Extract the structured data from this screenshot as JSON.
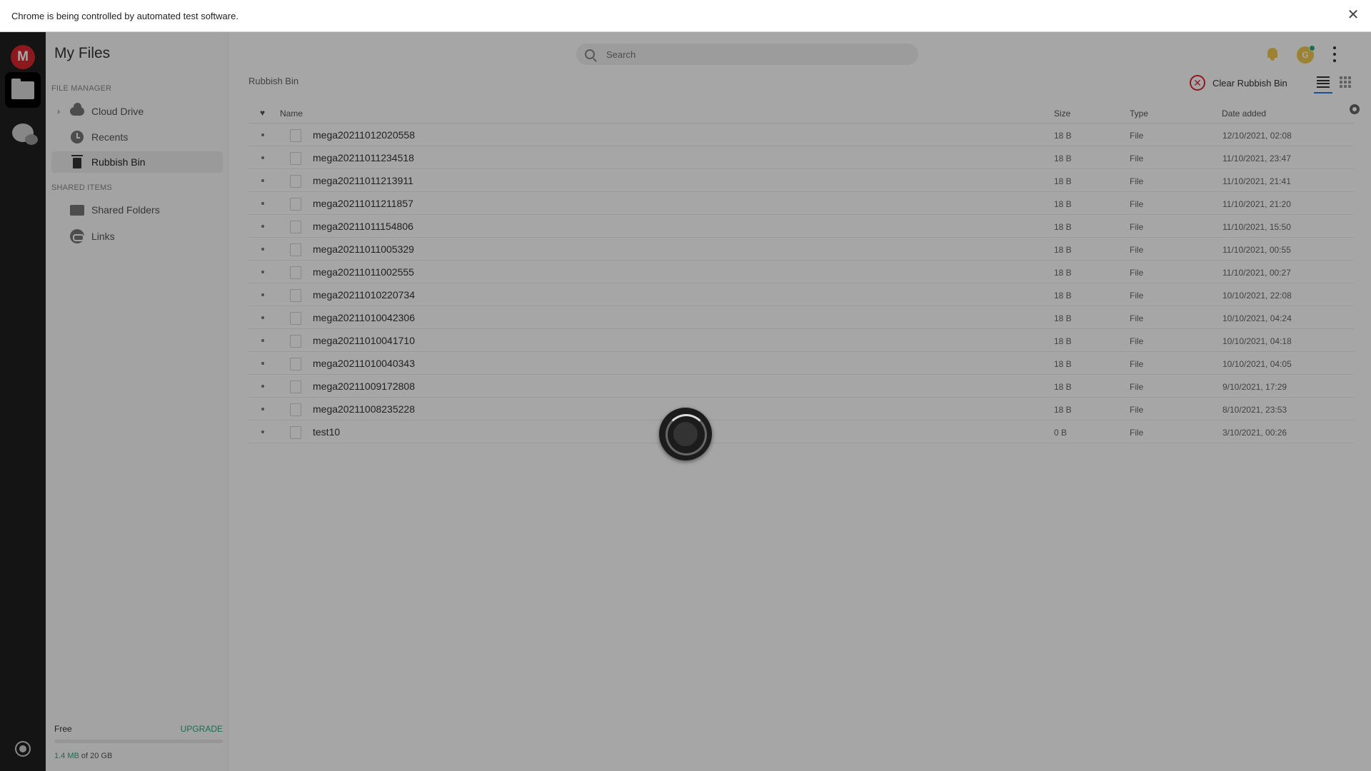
{
  "banner": {
    "text": "Chrome is being controlled by automated test software.",
    "close": "✕"
  },
  "rail": {
    "logo": "M"
  },
  "sidebar": {
    "title": "My Files",
    "file_manager_heading": "FILE MANAGER",
    "shared_heading": "SHARED ITEMS",
    "items": {
      "cloud": "Cloud Drive",
      "recents": "Recents",
      "rubbish": "Rubbish Bin",
      "shared_folders": "Shared Folders",
      "links": "Links"
    },
    "quota": {
      "plan": "Free",
      "upgrade": "UPGRADE",
      "used_amount": "1.4 MB",
      "used_suffix": " of 20 GB",
      "fill_fraction": 0.0001
    }
  },
  "header": {
    "search_placeholder": "Search",
    "avatar_letter": "G"
  },
  "toolbar": {
    "breadcrumb": "Rubbish Bin",
    "clear_label": "Clear Rubbish Bin"
  },
  "columns": {
    "name": "Name",
    "size": "Size",
    "type": "Type",
    "date": "Date added"
  },
  "rows": [
    {
      "name": "mega20211012020558",
      "size": "18 B",
      "type": "File",
      "date": "12/10/2021, 02:08"
    },
    {
      "name": "mega20211011234518",
      "size": "18 B",
      "type": "File",
      "date": "11/10/2021, 23:47"
    },
    {
      "name": "mega20211011213911",
      "size": "18 B",
      "type": "File",
      "date": "11/10/2021, 21:41"
    },
    {
      "name": "mega20211011211857",
      "size": "18 B",
      "type": "File",
      "date": "11/10/2021, 21:20"
    },
    {
      "name": "mega20211011154806",
      "size": "18 B",
      "type": "File",
      "date": "11/10/2021, 15:50"
    },
    {
      "name": "mega20211011005329",
      "size": "18 B",
      "type": "File",
      "date": "11/10/2021, 00:55"
    },
    {
      "name": "mega20211011002555",
      "size": "18 B",
      "type": "File",
      "date": "11/10/2021, 00:27"
    },
    {
      "name": "mega20211010220734",
      "size": "18 B",
      "type": "File",
      "date": "10/10/2021, 22:08"
    },
    {
      "name": "mega20211010042306",
      "size": "18 B",
      "type": "File",
      "date": "10/10/2021, 04:24"
    },
    {
      "name": "mega20211010041710",
      "size": "18 B",
      "type": "File",
      "date": "10/10/2021, 04:18"
    },
    {
      "name": "mega20211010040343",
      "size": "18 B",
      "type": "File",
      "date": "10/10/2021, 04:05"
    },
    {
      "name": "mega20211009172808",
      "size": "18 B",
      "type": "File",
      "date": "9/10/2021, 17:29"
    },
    {
      "name": "mega20211008235228",
      "size": "18 B",
      "type": "File",
      "date": "8/10/2021, 23:53"
    },
    {
      "name": "test10",
      "size": "0 B",
      "type": "File",
      "date": "3/10/2021, 00:26"
    }
  ]
}
